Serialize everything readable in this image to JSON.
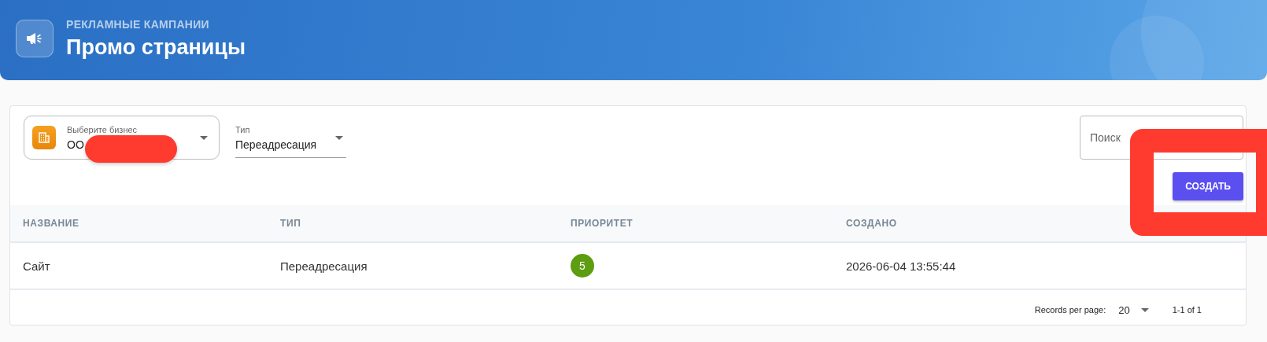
{
  "header": {
    "eyebrow": "РЕКЛАМНЫЕ КАМПАНИИ",
    "title": "Промо страницы"
  },
  "filters": {
    "business": {
      "label": "Выберите бизнес",
      "value": "ОО",
      "redacted": true
    },
    "type": {
      "label": "Тип",
      "value": "Переадресация"
    },
    "search": {
      "placeholder": "Поиск"
    }
  },
  "create_button": {
    "label": "СОЗДАТЬ",
    "highlighted": true
  },
  "table": {
    "columns": [
      "НАЗВАНИЕ",
      "ТИП",
      "ПРИОРИТЕТ",
      "СОЗДАНО"
    ],
    "rows": [
      {
        "name": "Сайт",
        "type": "Переадресация",
        "priority": "5",
        "created": "2026-06-04 13:55:44"
      }
    ]
  },
  "footer": {
    "records_label": "Records per page:",
    "per_page": "20",
    "range": "1-1 of 1"
  }
}
